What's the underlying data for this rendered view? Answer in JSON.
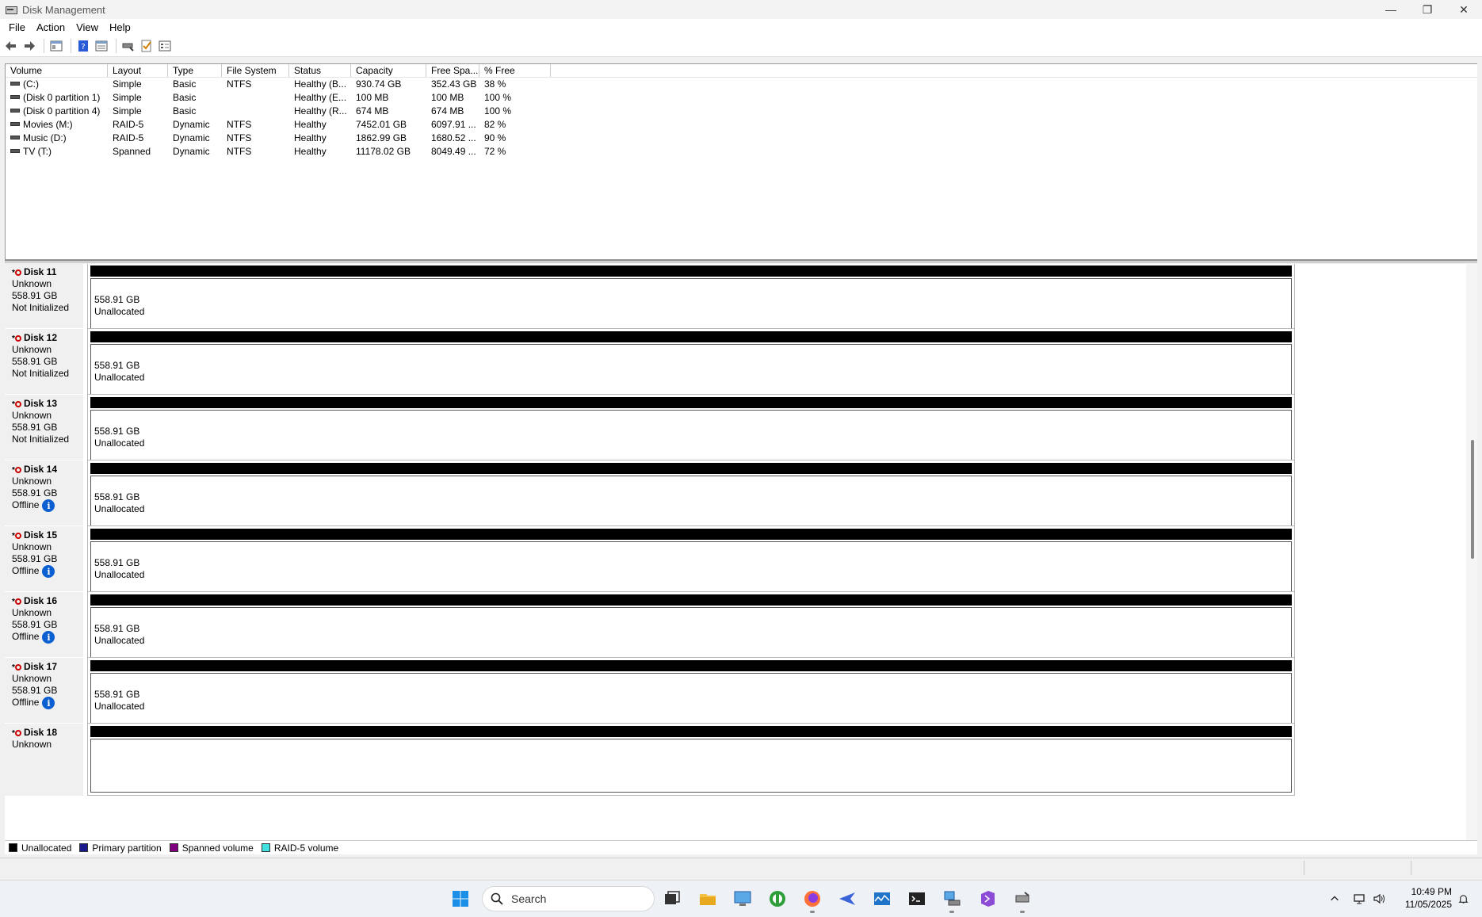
{
  "window": {
    "title": "Disk Management",
    "min": "—",
    "max": "❐",
    "close": "✕"
  },
  "menu": [
    "File",
    "Action",
    "View",
    "Help"
  ],
  "columns": {
    "volume": "Volume",
    "layout": "Layout",
    "type": "Type",
    "filesystem": "File System",
    "status": "Status",
    "capacity": "Capacity",
    "free": "Free Spa...",
    "pct": "% Free"
  },
  "volumes": [
    {
      "volume": "(C:)",
      "layout": "Simple",
      "type": "Basic",
      "fs": "NTFS",
      "status": "Healthy (B...",
      "capacity": "930.74 GB",
      "free": "352.43 GB",
      "pct": "38 %"
    },
    {
      "volume": "(Disk 0 partition 1)",
      "layout": "Simple",
      "type": "Basic",
      "fs": "",
      "status": "Healthy (E...",
      "capacity": "100 MB",
      "free": "100 MB",
      "pct": "100 %"
    },
    {
      "volume": "(Disk 0 partition 4)",
      "layout": "Simple",
      "type": "Basic",
      "fs": "",
      "status": "Healthy (R...",
      "capacity": "674 MB",
      "free": "674 MB",
      "pct": "100 %"
    },
    {
      "volume": "Movies (M:)",
      "layout": "RAID-5",
      "type": "Dynamic",
      "fs": "NTFS",
      "status": "Healthy",
      "capacity": "7452.01 GB",
      "free": "6097.91 ...",
      "pct": "82 %"
    },
    {
      "volume": "Music (D:)",
      "layout": "RAID-5",
      "type": "Dynamic",
      "fs": "NTFS",
      "status": "Healthy",
      "capacity": "1862.99 GB",
      "free": "1680.52 ...",
      "pct": "90 %"
    },
    {
      "volume": "TV (T:)",
      "layout": "Spanned",
      "type": "Dynamic",
      "fs": "NTFS",
      "status": "Healthy",
      "capacity": "11178.02 GB",
      "free": "8049.49 ...",
      "pct": "72 %"
    }
  ],
  "disks": [
    {
      "name": "Disk 11",
      "type": "Unknown",
      "size": "558.91 GB",
      "state": "Not Initialized",
      "info": false,
      "part_size": "558.91 GB",
      "part_label": "Unallocated"
    },
    {
      "name": "Disk 12",
      "type": "Unknown",
      "size": "558.91 GB",
      "state": "Not Initialized",
      "info": false,
      "part_size": "558.91 GB",
      "part_label": "Unallocated"
    },
    {
      "name": "Disk 13",
      "type": "Unknown",
      "size": "558.91 GB",
      "state": "Not Initialized",
      "info": false,
      "part_size": "558.91 GB",
      "part_label": "Unallocated"
    },
    {
      "name": "Disk 14",
      "type": "Unknown",
      "size": "558.91 GB",
      "state": "Offline",
      "info": true,
      "part_size": "558.91 GB",
      "part_label": "Unallocated"
    },
    {
      "name": "Disk 15",
      "type": "Unknown",
      "size": "558.91 GB",
      "state": "Offline",
      "info": true,
      "part_size": "558.91 GB",
      "part_label": "Unallocated"
    },
    {
      "name": "Disk 16",
      "type": "Unknown",
      "size": "558.91 GB",
      "state": "Offline",
      "info": true,
      "part_size": "558.91 GB",
      "part_label": "Unallocated"
    },
    {
      "name": "Disk 17",
      "type": "Unknown",
      "size": "558.91 GB",
      "state": "Offline",
      "info": true,
      "part_size": "558.91 GB",
      "part_label": "Unallocated"
    },
    {
      "name": "Disk 18",
      "type": "Unknown",
      "size": "",
      "state": "",
      "info": false,
      "part_size": "",
      "part_label": ""
    }
  ],
  "info_glyph": "i",
  "legend": [
    {
      "label": "Unallocated",
      "color": "#000000"
    },
    {
      "label": "Primary partition",
      "color": "#1a1a8c"
    },
    {
      "label": "Spanned volume",
      "color": "#800080"
    },
    {
      "label": "RAID-5 volume",
      "color": "#40e0e0"
    }
  ],
  "taskbar": {
    "search_placeholder": "Search",
    "time": "10:49 PM",
    "date": "11/05/2025"
  }
}
